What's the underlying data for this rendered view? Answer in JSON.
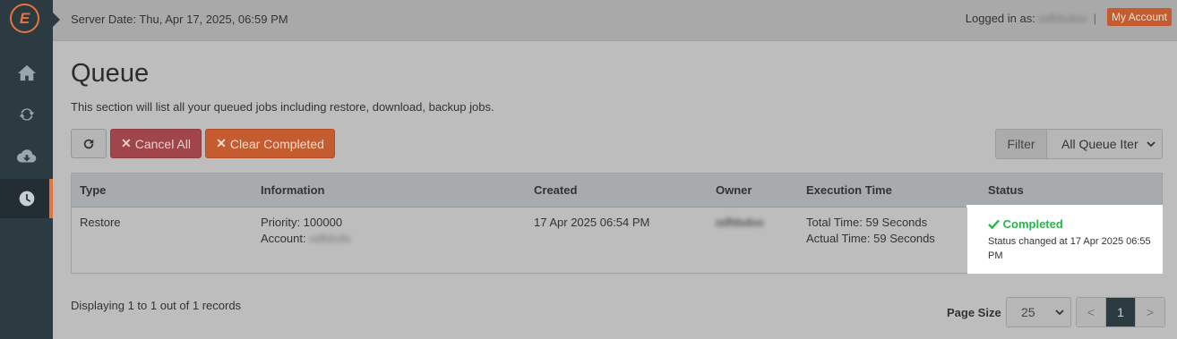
{
  "header": {
    "server_date": "Server Date: Thu, Apr 17, 2025, 06:59 PM",
    "logged_in_label": "Logged in as:",
    "username": "odfdsdoo",
    "separator": "|",
    "my_account": "My Account"
  },
  "sidebar": {
    "logo_glyph": "E",
    "items": [
      {
        "icon": "home-icon",
        "active": false
      },
      {
        "icon": "refresh-icon",
        "active": false
      },
      {
        "icon": "cloud-download-icon",
        "active": false
      },
      {
        "icon": "clock-icon",
        "active": true
      }
    ]
  },
  "page": {
    "title": "Queue",
    "description": "This section will list all your queued jobs including restore, download, backup jobs."
  },
  "toolbar": {
    "cancel_all": "Cancel All",
    "clear_completed": "Clear Completed",
    "x_glyph": "✕",
    "filter_label": "Filter",
    "filter_value": "All Queue Iter"
  },
  "table": {
    "headers": [
      "Type",
      "Information",
      "Created",
      "Owner",
      "Execution Time",
      "Status"
    ],
    "rows": [
      {
        "type": "Restore",
        "priority": "Priority: 100000",
        "account_label": "Account:",
        "account_value": "odfdsdo",
        "created": "17 Apr 2025 06:54 PM",
        "owner": "odfdsdoo",
        "total_time": "Total Time: 59 Seconds",
        "actual_time": "Actual Time: 59 Seconds",
        "status": "Completed",
        "status_changed": "Status changed at 17 Apr 2025 06:55 PM"
      }
    ]
  },
  "footer": {
    "records": "Displaying 1 to 1 out of 1 records",
    "page_size_label": "Page Size",
    "page_size_value": "25",
    "prev": "<",
    "current_page": "1",
    "next": ">"
  },
  "colors": {
    "accent": "#e8743b",
    "sidebar": "#2c3a41",
    "danger": "#a0454a",
    "success": "#2db34a"
  }
}
